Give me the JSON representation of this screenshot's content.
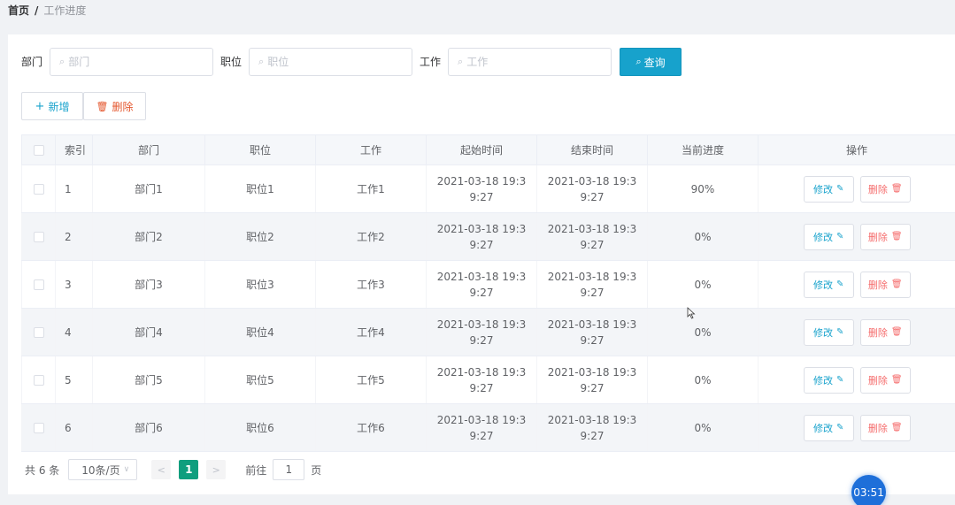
{
  "breadcrumb": {
    "home": "首页",
    "separator": "/",
    "current": "工作进度"
  },
  "filters": {
    "dept_label": "部门",
    "dept_placeholder": "部门",
    "position_label": "职位",
    "position_placeholder": "职位",
    "job_label": "工作",
    "job_placeholder": "工作",
    "query_label": "查询"
  },
  "actions": {
    "add_label": "新增",
    "delete_label": "删除"
  },
  "table": {
    "headers": {
      "index": "索引",
      "dept": "部门",
      "position": "职位",
      "job": "工作",
      "start": "起始时间",
      "end": "结束时间",
      "progress": "当前进度",
      "ops": "操作"
    },
    "rows": [
      {
        "index": "1",
        "dept": "部门1",
        "position": "职位1",
        "job": "工作1",
        "start": "2021-03-18 19:39:27",
        "end": "2021-03-18 19:39:27",
        "progress": "90%"
      },
      {
        "index": "2",
        "dept": "部门2",
        "position": "职位2",
        "job": "工作2",
        "start": "2021-03-18 19:39:27",
        "end": "2021-03-18 19:39:27",
        "progress": "0%"
      },
      {
        "index": "3",
        "dept": "部门3",
        "position": "职位3",
        "job": "工作3",
        "start": "2021-03-18 19:39:27",
        "end": "2021-03-18 19:39:27",
        "progress": "0%"
      },
      {
        "index": "4",
        "dept": "部门4",
        "position": "职位4",
        "job": "工作4",
        "start": "2021-03-18 19:39:27",
        "end": "2021-03-18 19:39:27",
        "progress": "0%"
      },
      {
        "index": "5",
        "dept": "部门5",
        "position": "职位5",
        "job": "工作5",
        "start": "2021-03-18 19:39:27",
        "end": "2021-03-18 19:39:27",
        "progress": "0%"
      },
      {
        "index": "6",
        "dept": "部门6",
        "position": "职位6",
        "job": "工作6",
        "start": "2021-03-18 19:39:27",
        "end": "2021-03-18 19:39:27",
        "progress": "0%"
      }
    ],
    "edit_label": "修改",
    "delete_label": "删除"
  },
  "pagination": {
    "total": "共 6 条",
    "page_size": "10条/页",
    "current_page": "1",
    "goto_label": "前往",
    "goto_value": "1",
    "page_suffix": "页"
  },
  "timer": "03:51",
  "colors": {
    "primary": "#17a2cc",
    "danger": "#f56c6c",
    "page_active": "#0e9e7e",
    "timer": "#1e6fd9"
  }
}
